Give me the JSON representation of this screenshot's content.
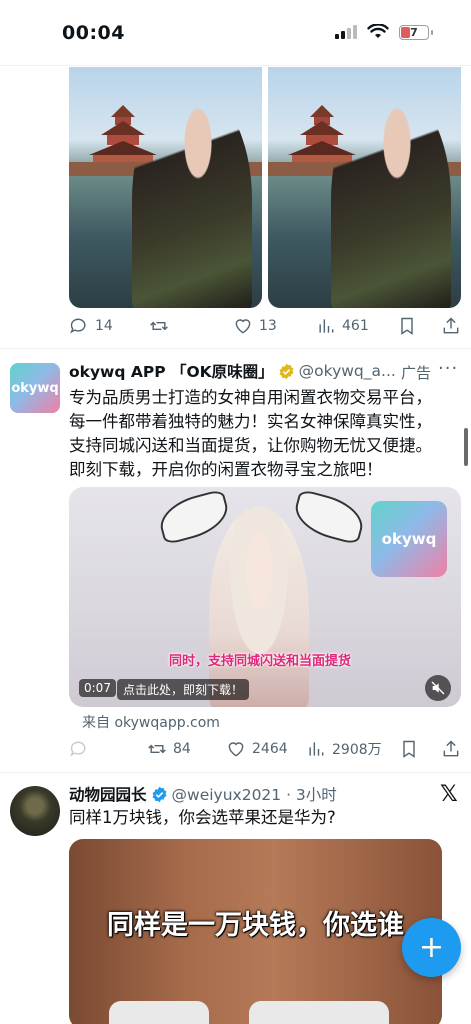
{
  "status_bar": {
    "time": "00:04",
    "battery": "7"
  },
  "post1": {
    "stats": {
      "replies": "14",
      "likes": "13",
      "views": "461"
    }
  },
  "ad_post": {
    "name": "okywq APP 「OK原味圈」",
    "handle": "@okywq_a...",
    "ad_label": "广告",
    "text_lines": [
      "专为品质男士打造的女神自用闲置衣物交易平台，",
      "每一件都带着独特的魅力！实名女神保障真实性，",
      "支持同城闪送和当面提货，让你购物无忧又便捷。",
      "即刻下载，开启你的闲置衣物寻宝之旅吧！"
    ],
    "avatar_text": "okywq",
    "video": {
      "logo_text": "okywq",
      "subtitle": "同时，支持同城闪送和当面提货",
      "duration": "0:07",
      "cta": "点击此处，即刻下载！"
    },
    "from": "来自 okywqapp.com",
    "stats": {
      "retweets": "84",
      "likes": "2464",
      "views": "2908万"
    }
  },
  "post3": {
    "name": "动物园园长",
    "handle": "@weiyux2021 · 3小时",
    "text": "同样1万块钱，你会选苹果还是华为?",
    "image_caption": "同样是一万块钱，你选谁"
  },
  "fab": {
    "label": "+"
  },
  "colors": {
    "accent": "#1d9bf0",
    "text": "#0f1419",
    "muted": "#536471",
    "verified_gold": "#e2b719",
    "verified_blue": "#1d9bf0"
  },
  "icons": [
    "reply-icon",
    "retweet-icon",
    "like-icon",
    "views-icon",
    "bookmark-icon",
    "share-icon",
    "mute-icon",
    "verified-icon",
    "x-logo-icon"
  ]
}
